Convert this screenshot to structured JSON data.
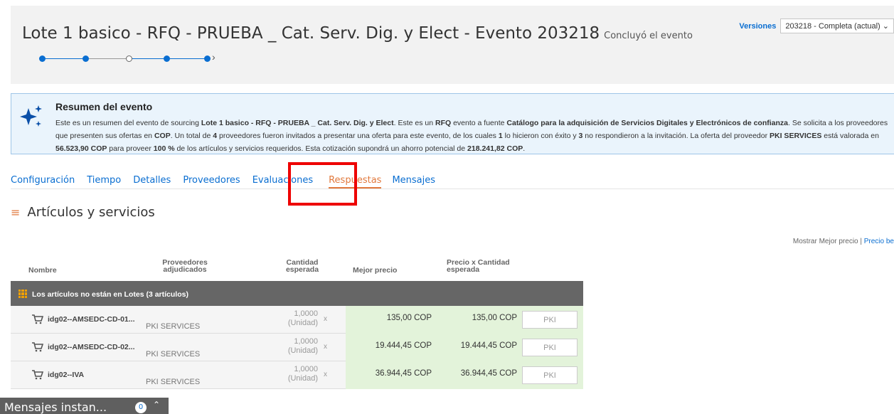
{
  "event": {
    "title": "Lote 1 basico - RFQ - PRUEBA _ Cat. Serv. Dig. y Elect - Evento 203218",
    "status": "Concluyó el evento",
    "versions_label": "Versiones",
    "version_selected": "203218 - Completa (actual)"
  },
  "summary": {
    "title": "Resumen del evento",
    "text_parts": [
      "Este es un resumen del evento de sourcing ",
      "Lote 1 basico - RFQ - PRUEBA _ Cat. Serv. Dig. y Elect",
      ". Este es un ",
      "RFQ",
      " evento a fuente ",
      "Catálogo para la adquisición de Servicios Digitales y Electrónicos de confianza",
      ". Se solicita a los proveedores que presenten sus ofertas en ",
      "COP",
      ". Un total de ",
      "4",
      " proveedores fueron invitados a presentar una oferta para este evento, de los cuales ",
      "1",
      " lo hicieron con éxito y ",
      "3",
      " no respondieron a la invitación. La oferta del proveedor ",
      "PKI SERVICES",
      " está valorada en ",
      "56.523,90 COP",
      " para proveer ",
      "100 %",
      " de los artículos y servicios requeridos. Esta cotización supondrá un ahorro potencial de ",
      "218.241,82 COP",
      "."
    ]
  },
  "tabs": [
    "Configuración",
    "Tiempo",
    "Detalles",
    "Proveedores",
    "Evaluaciones",
    "Respuestas",
    "Mensajes"
  ],
  "active_tab": "Respuestas",
  "section": {
    "title": "Artículos y servicios",
    "show_label": "Mostrar Mejor precio | ",
    "show_link": "Precio be"
  },
  "table": {
    "headers": {
      "name": "Nombre",
      "suppliers": "Proveedores adjudicados",
      "qty": "Cantidad esperada",
      "best": "Mejor precio",
      "pq": "Precio x Cantidad esperada"
    },
    "group": "Los artículos no están en Lotes (3 artículos)",
    "rows": [
      {
        "name": "idg02--AMSEDC-CD-01...",
        "supplier": "PKI SERVICES",
        "qty": "1,0000",
        "unit": "(Unidad)",
        "x": "x",
        "best": "135,00 COP",
        "pq": "135,00 COP",
        "pki": "PKI"
      },
      {
        "name": "idg02--AMSEDC-CD-02...",
        "supplier": "PKI SERVICES",
        "qty": "1,0000",
        "unit": "(Unidad)",
        "x": "x",
        "best": "19.444,45 COP",
        "pq": "19.444,45 COP",
        "pki": "PKI"
      },
      {
        "name": "idg02--IVA",
        "supplier": "PKI SERVICES",
        "qty": "1,0000",
        "unit": "(Unidad)",
        "x": "x",
        "best": "36.944,45 COP",
        "pq": "36.944,45 COP",
        "pki": "PKI"
      }
    ]
  },
  "dock": {
    "label": "Mensajes instan...",
    "count": "0"
  },
  "colors": {
    "brand": "#0a6ed1",
    "accent": "#e1793d",
    "highlight": "#ee0000",
    "best_price_bg": "#e3f3da"
  }
}
